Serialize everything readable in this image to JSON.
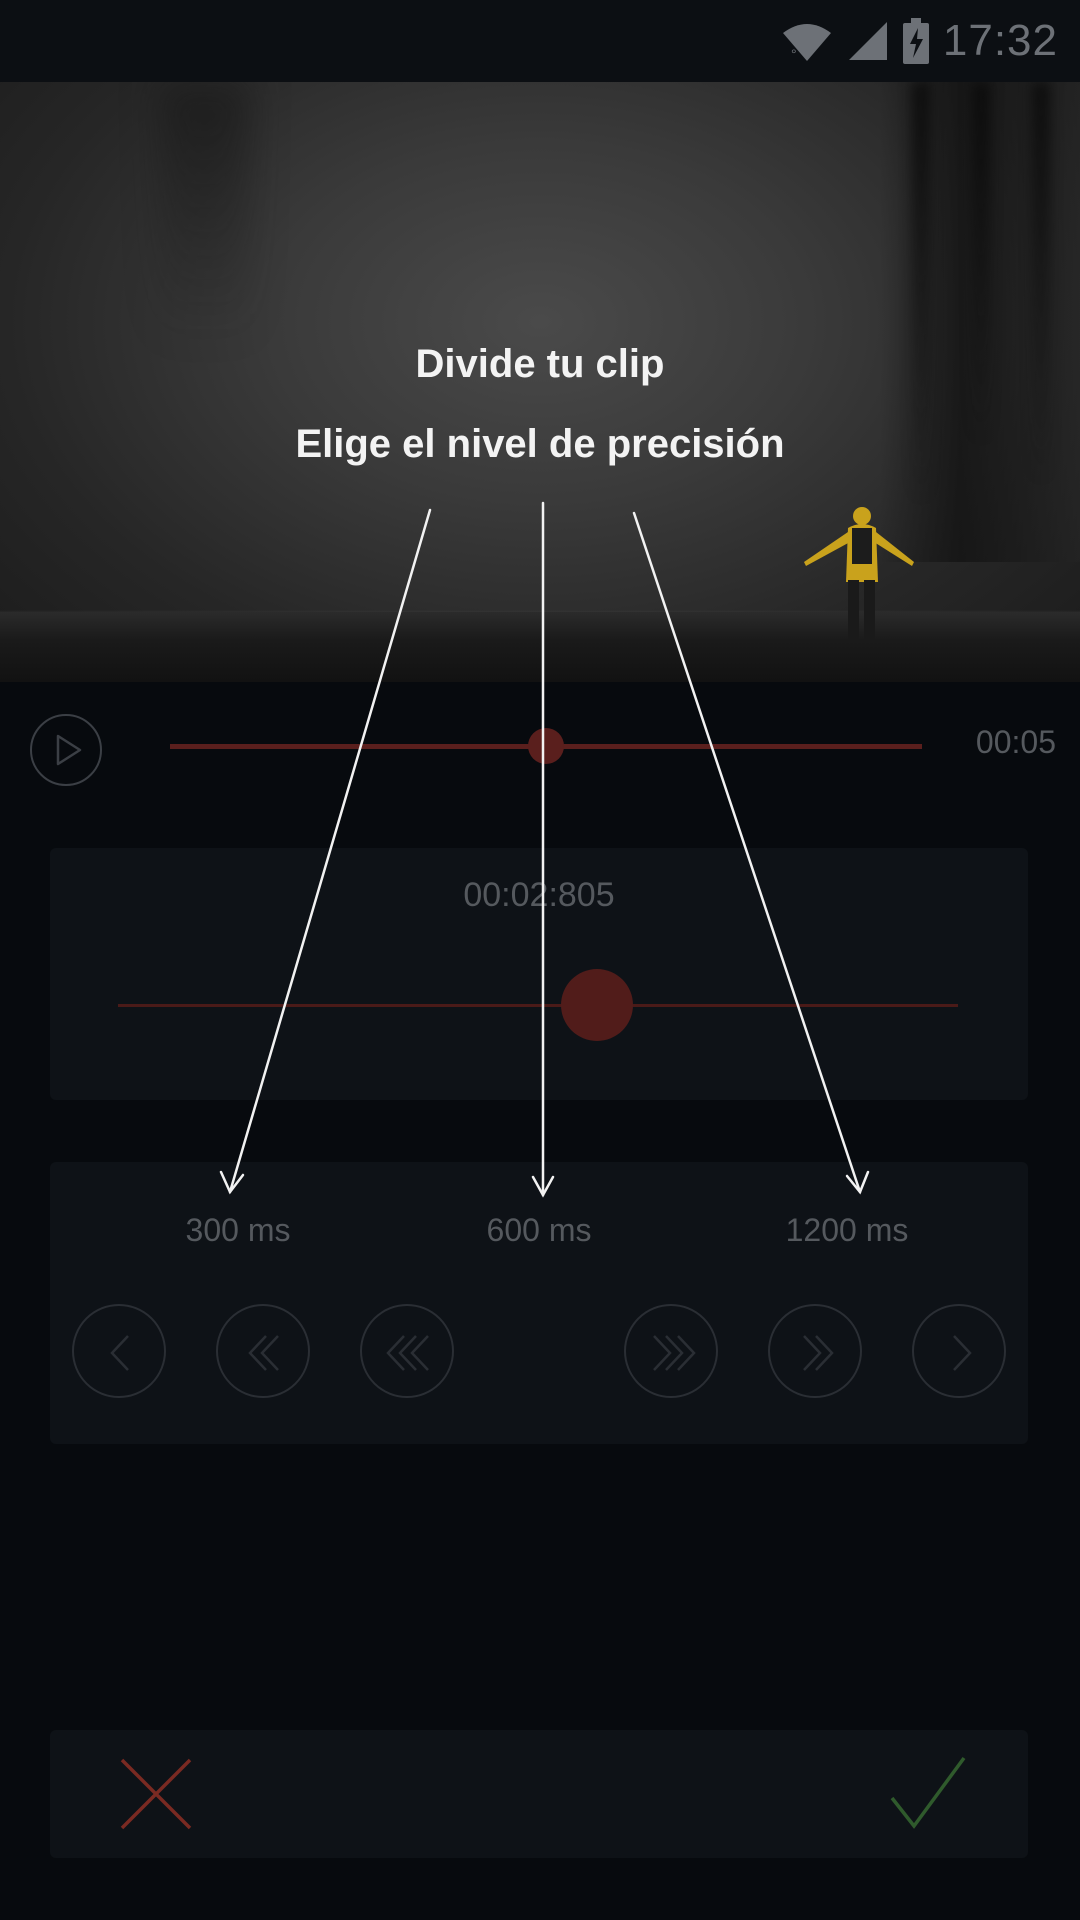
{
  "status_bar": {
    "time": "17:32",
    "icons": [
      "wifi-icon",
      "cell-signal-icon",
      "battery-charging-icon"
    ]
  },
  "overlay": {
    "title": "Divide tu clip",
    "subtitle": "Elige el nivel de precisión"
  },
  "player": {
    "duration": "00:05",
    "progress": 0.5
  },
  "fine_tuner": {
    "position": "00:02:805",
    "progress": 0.57
  },
  "step_controls": {
    "levels": [
      "300 ms",
      "600 ms",
      "1200 ms"
    ],
    "buttons": [
      "step-back-300-icon",
      "step-back-600-icon",
      "step-back-1200-icon",
      "step-forward-1200-icon",
      "step-forward-600-icon",
      "step-forward-300-icon"
    ]
  },
  "actions": {
    "cancel_icon": "close-icon",
    "confirm_icon": "check-icon"
  },
  "colors": {
    "accent_red": "#5a1f1d",
    "cancel_red": "#7a2a22",
    "confirm_green": "#2f5a2c",
    "background": "#070a0e",
    "panel": "#0e1217"
  }
}
